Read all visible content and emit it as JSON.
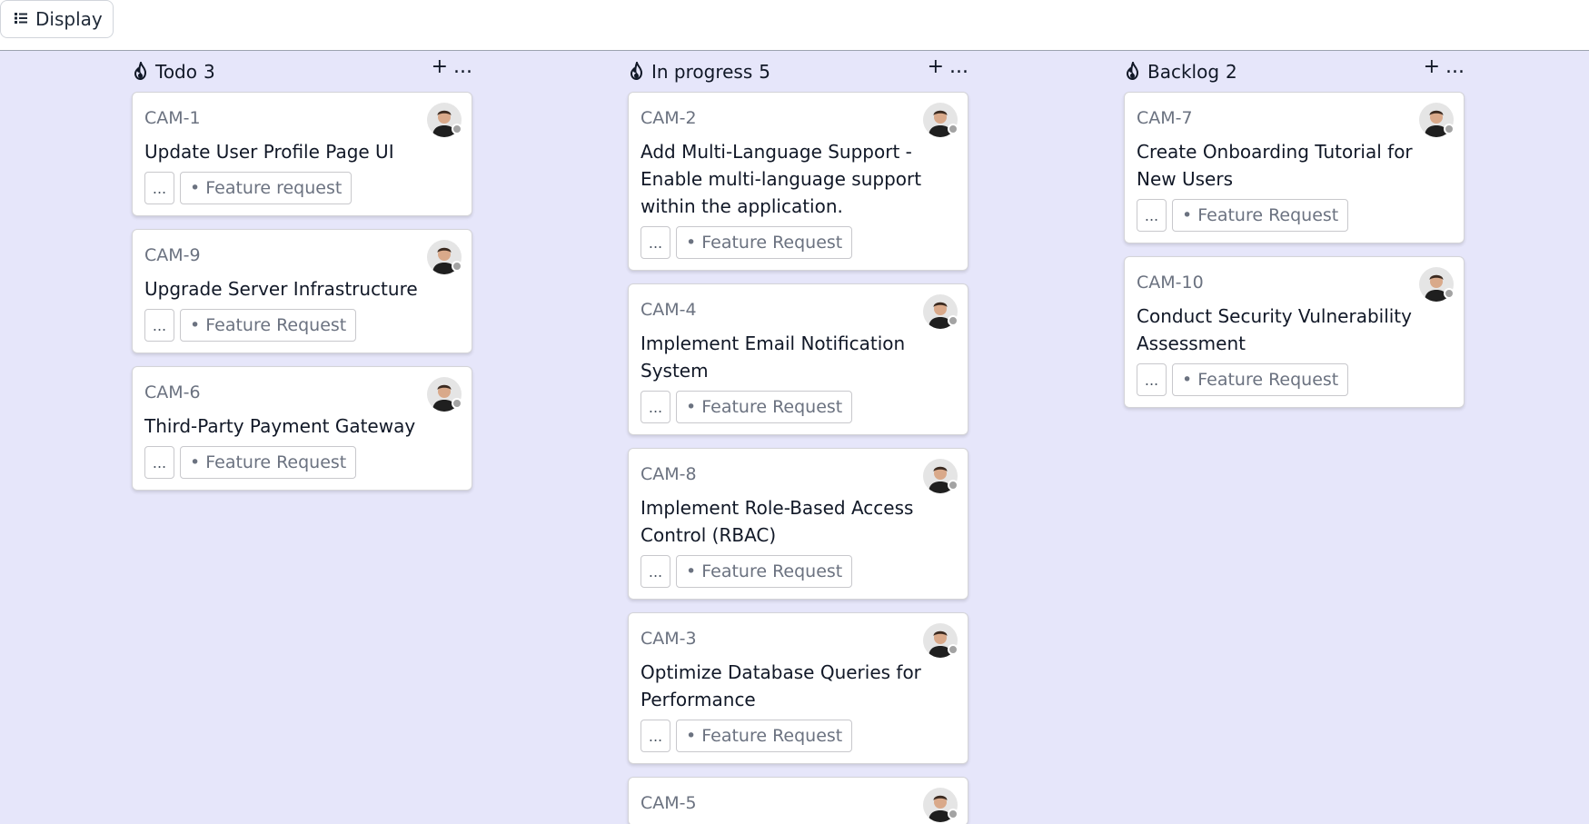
{
  "toolbar": {
    "display_label": "Display"
  },
  "columns": [
    {
      "title": "Todo",
      "count": "3",
      "add_label": "+",
      "more_label": "...",
      "cards": [
        {
          "id": "CAM-1",
          "title": "Update User Profile Page UI",
          "more": "...",
          "tag": "• Feature request"
        },
        {
          "id": "CAM-9",
          "title": "Upgrade Server Infrastructure",
          "more": "...",
          "tag": "• Feature Request"
        },
        {
          "id": "CAM-6",
          "title": "Third-Party Payment Gateway",
          "more": "...",
          "tag": "• Feature Request"
        }
      ]
    },
    {
      "title": "In progress",
      "count": "5",
      "add_label": "+",
      "more_label": "...",
      "cards": [
        {
          "id": "CAM-2",
          "title": "Add Multi-Language Support - Enable multi-language support within the application.",
          "more": "...",
          "tag": "• Feature Request"
        },
        {
          "id": "CAM-4",
          "title": "Implement Email Notification System",
          "more": "...",
          "tag": "• Feature Request"
        },
        {
          "id": "CAM-8",
          "title": "Implement Role-Based Access Control (RBAC)",
          "more": "...",
          "tag": "• Feature Request"
        },
        {
          "id": "CAM-3",
          "title": "Optimize Database Queries for Performance",
          "more": "...",
          "tag": "• Feature Request"
        },
        {
          "id": "CAM-5",
          "title": "",
          "more": "",
          "tag": ""
        }
      ]
    },
    {
      "title": "Backlog",
      "count": "2",
      "add_label": "+",
      "more_label": "...",
      "cards": [
        {
          "id": "CAM-7",
          "title": "Create Onboarding Tutorial for New Users",
          "more": "...",
          "tag": "• Feature Request"
        },
        {
          "id": "CAM-10",
          "title": "Conduct Security Vulnerability Assessment",
          "more": "...",
          "tag": "• Feature Request"
        }
      ]
    }
  ],
  "colors": {
    "board_bg": "#e6e6fa",
    "card_bg": "#ffffff",
    "status_dot": "#a3a3a3"
  }
}
